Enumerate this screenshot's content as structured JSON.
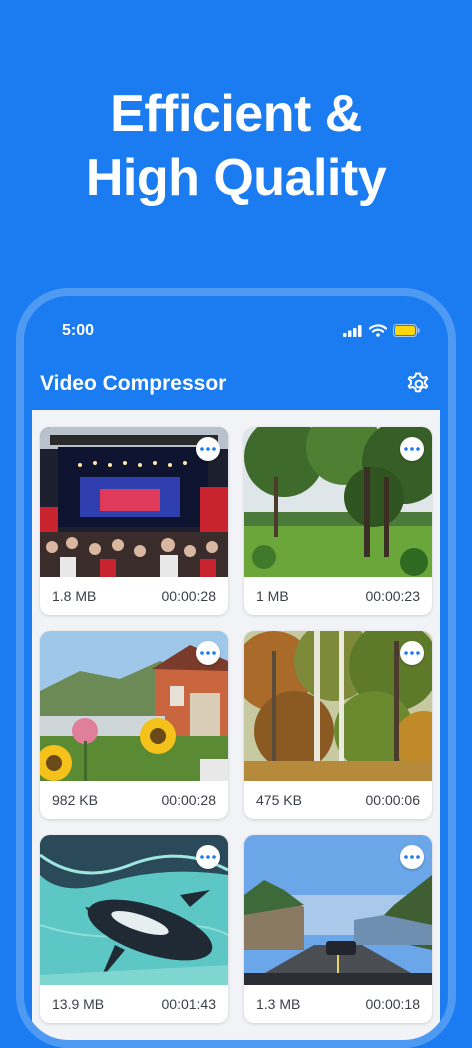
{
  "headline": {
    "line1": "Efficient &",
    "line2": "High Quality"
  },
  "status_bar": {
    "time": "5:00",
    "icons": [
      "signal-icon",
      "wifi-icon",
      "battery-icon"
    ],
    "battery_color": "#ffd60a"
  },
  "app_bar": {
    "title": "Video Compressor",
    "settings_icon": "gear-icon"
  },
  "colors": {
    "brand_blue": "#1a7cf0",
    "phone_frame": "#4e9af2",
    "content_bg": "#f2f3f6",
    "text": "#3b3f46"
  },
  "videos": [
    {
      "scene": "concert",
      "size": "1.8 MB",
      "duration": "00:00:28",
      "more_icon": "more-dots-icon"
    },
    {
      "scene": "forest-meadow",
      "size": "1 MB",
      "duration": "00:00:23",
      "more_icon": "more-dots-icon"
    },
    {
      "scene": "garden-flowers",
      "size": "982 KB",
      "duration": "00:00:28",
      "more_icon": "more-dots-icon"
    },
    {
      "scene": "autumn-birch-forest",
      "size": "475 KB",
      "duration": "00:00:06",
      "more_icon": "more-dots-icon"
    },
    {
      "scene": "penguin-underwater",
      "size": "13.9 MB",
      "duration": "00:01:43",
      "more_icon": "more-dots-icon"
    },
    {
      "scene": "road-drive",
      "size": "1.3 MB",
      "duration": "00:00:18",
      "more_icon": "more-dots-icon"
    }
  ]
}
